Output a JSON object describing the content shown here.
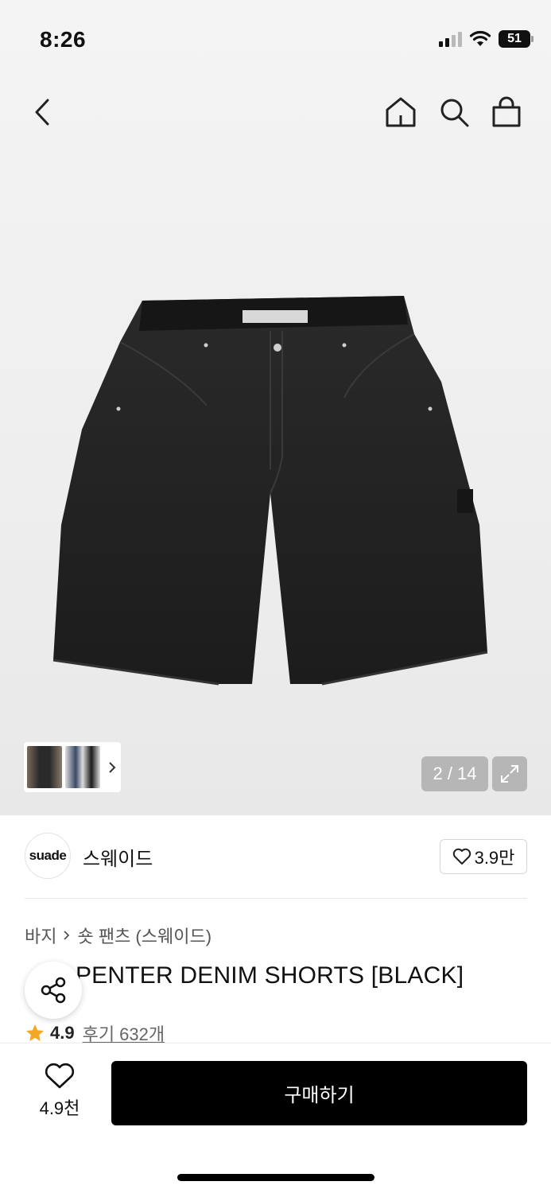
{
  "status_bar": {
    "time": "8:26",
    "battery_level": "51",
    "icons": [
      "signal-icon",
      "wifi-icon",
      "battery-icon"
    ]
  },
  "nav": {
    "icons": [
      "back-icon",
      "home-icon",
      "search-icon",
      "shopping-bag-icon"
    ]
  },
  "gallery": {
    "image": "black-denim-shorts",
    "counter": "2 / 14",
    "current_index": 2,
    "total": 14,
    "thumbnail_strip_icon": "chevron-right-icon",
    "expand_icon": "expand-icon"
  },
  "brand": {
    "logo_text": "suade",
    "name": "스웨이드",
    "like_count": "3.9만",
    "like_icon": "heart-outline-icon"
  },
  "breadcrumb": {
    "items": [
      "바지",
      "숏 팬츠 (스웨이드)"
    ],
    "separator_icon": "chevron-right-icon"
  },
  "product": {
    "title": "CARPENTER DENIM SHORTS [BLACK]",
    "title_visible": "PENTER DENIM SHORTS [BLACK]",
    "rating": "4.9",
    "reviews": "후기 632개",
    "star_icon": "star-icon",
    "share_icon": "share-icon"
  },
  "bottom_bar": {
    "wish_count": "4.9천",
    "wish_icon": "heart-outline-icon",
    "buy_label": "구매하기"
  },
  "colors": {
    "accent_star": "#f5a623",
    "primary_button": "#000000",
    "background": "#ffffff"
  }
}
